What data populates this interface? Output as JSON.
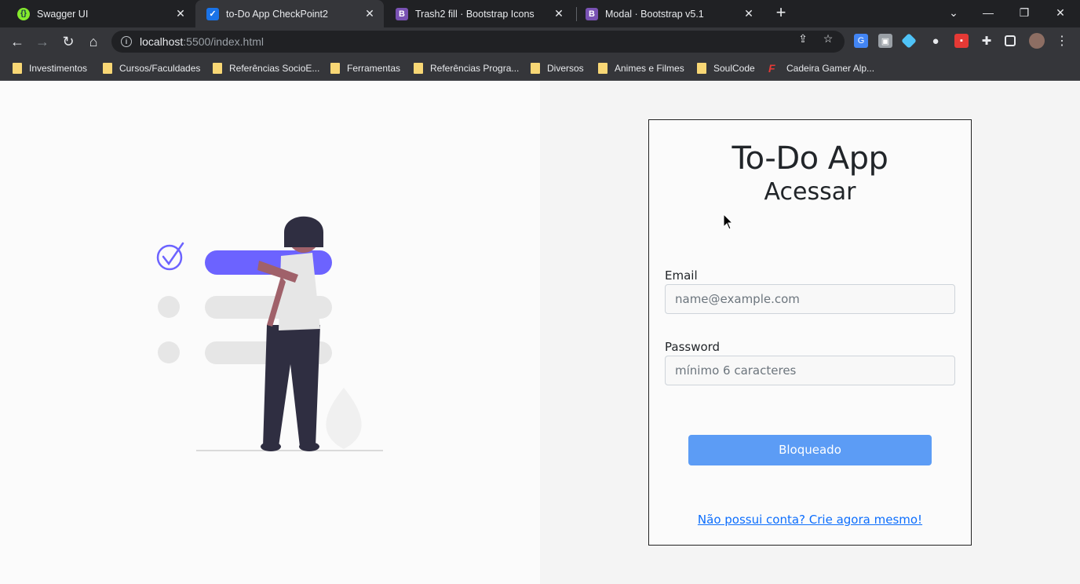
{
  "browser": {
    "tabs": [
      {
        "title": "Swagger UI",
        "favicon_color": "#85ea2d",
        "favicon_glyph": "",
        "active": false
      },
      {
        "title": "to-Do App CheckPoint2",
        "favicon_color": "#1a73e8",
        "favicon_glyph": "✓",
        "active": true
      },
      {
        "title": "Trash2 fill · Bootstrap Icons",
        "favicon_color": "#7952b3",
        "favicon_glyph": "B",
        "active": false
      },
      {
        "title": "Modal · Bootstrap v5.1",
        "favicon_color": "#7952b3",
        "favicon_glyph": "B",
        "active": false
      }
    ],
    "url_host": "localhost",
    "url_path": ":5500/index.html",
    "bookmarks": [
      {
        "label": "Investimentos",
        "icon": "folder-icon"
      },
      {
        "label": "Cursos/Faculdades",
        "icon": "folder-icon"
      },
      {
        "label": "Referências SocioE...",
        "icon": "folder-icon"
      },
      {
        "label": "Ferramentas",
        "icon": "folder-icon"
      },
      {
        "label": "Referências Progra...",
        "icon": "folder-icon"
      },
      {
        "label": "Diversos",
        "icon": "folder-icon"
      },
      {
        "label": "Animes e Filmes",
        "icon": "folder-icon"
      },
      {
        "label": "SoulCode",
        "icon": "folder-icon"
      },
      {
        "label": "Cadeira Gamer Alp...",
        "icon": "f-logo-icon"
      }
    ]
  },
  "login": {
    "title": "To-Do App",
    "subtitle": "Acessar",
    "email_label": "Email",
    "email_placeholder": "name@example.com",
    "password_label": "Password",
    "password_placeholder": "mínimo 6 caracteres",
    "submit_label": "Bloqueado",
    "signup_link": "Não possui conta? Crie agora mesmo!"
  },
  "colors": {
    "accent_purple": "#6c63ff",
    "button_disabled": "#5c9cf5",
    "link": "#0d6efd"
  }
}
